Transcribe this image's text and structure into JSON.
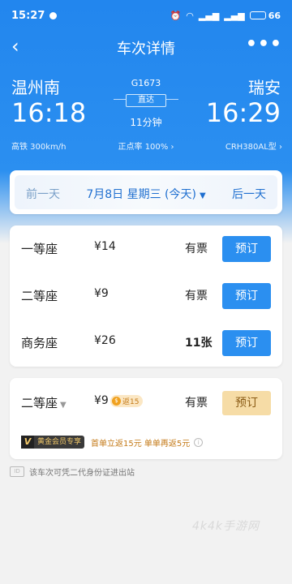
{
  "status_bar": {
    "time": "15:27",
    "battery": "66"
  },
  "nav": {
    "back": "‹",
    "title": "车次详情",
    "more": "•••"
  },
  "train": {
    "from_station": "温州南",
    "from_time": "16:18",
    "from_type": "高铁 300km/h",
    "to_station": "瑞安",
    "to_time": "16:29",
    "to_model": "CRH380AL型 ›",
    "number": "G1673",
    "direct": "直达",
    "duration": "11分钟",
    "ontime": "正点率 100% ›"
  },
  "date_selector": {
    "prev": "前一天",
    "current": "7月8日 星期三 (今天)",
    "next": "后一天"
  },
  "seats": [
    {
      "name": "一等座",
      "price": "¥14",
      "availability": "有票",
      "action": "预订"
    },
    {
      "name": "二等座",
      "price": "¥9",
      "availability": "有票",
      "action": "预订"
    },
    {
      "name": "商务座",
      "price": "¥26",
      "availability": "11张",
      "action": "预订"
    }
  ],
  "vip_seat": {
    "name": "二等座",
    "price": "¥9",
    "rebate": "返15",
    "availability": "有票",
    "action": "预订",
    "vip_tag": "黄金会员专享",
    "promo": "首单立返15元 单单再返5元"
  },
  "id_note": {
    "icon": "ID",
    "text": "该车次可凭二代身份证进出站"
  },
  "watermark": "4k4k手游网",
  "colors": {
    "primary": "#2b8ff0",
    "vip_button": "#f6dca6",
    "rebate": "#f0a11f"
  }
}
